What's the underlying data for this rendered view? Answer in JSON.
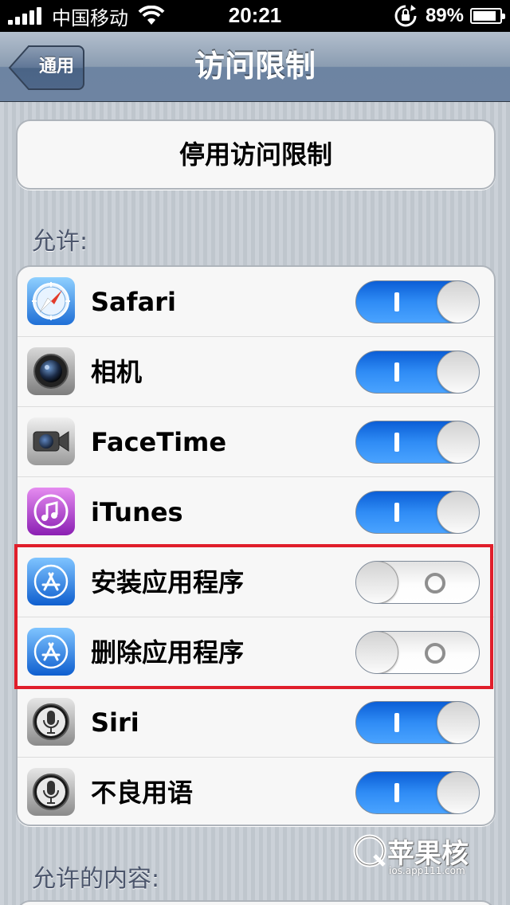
{
  "status_bar": {
    "carrier": "中国移动",
    "time": "20:21",
    "battery_percent": "89%",
    "battery_level": 0.89
  },
  "nav": {
    "back_label": "通用",
    "title": "访问限制"
  },
  "disable_button": {
    "label": "停用访问限制"
  },
  "sections": {
    "allow_header": "允许:",
    "allowed_content_header": "允许的内容:"
  },
  "allow_items": [
    {
      "label": "Safari",
      "icon": "safari-icon",
      "state": "on"
    },
    {
      "label": "相机",
      "icon": "camera-icon",
      "state": "on"
    },
    {
      "label": "FaceTime",
      "icon": "facetime-icon",
      "state": "on"
    },
    {
      "label": "iTunes",
      "icon": "itunes-icon",
      "state": "on"
    },
    {
      "label": "安装应用程序",
      "icon": "app-store-icon",
      "state": "off"
    },
    {
      "label": "删除应用程序",
      "icon": "app-store-icon",
      "state": "off"
    },
    {
      "label": "Siri",
      "icon": "siri-microphone-icon",
      "state": "on"
    },
    {
      "label": "不良用语",
      "icon": "siri-microphone-icon",
      "state": "on"
    }
  ],
  "colors": {
    "toggle_on": "#2f8cf5",
    "highlight_box": "#e01e2b",
    "nav_bar": "#6d84a2"
  },
  "watermark": {
    "text": "苹果核",
    "sub": "ios.app111.com"
  }
}
